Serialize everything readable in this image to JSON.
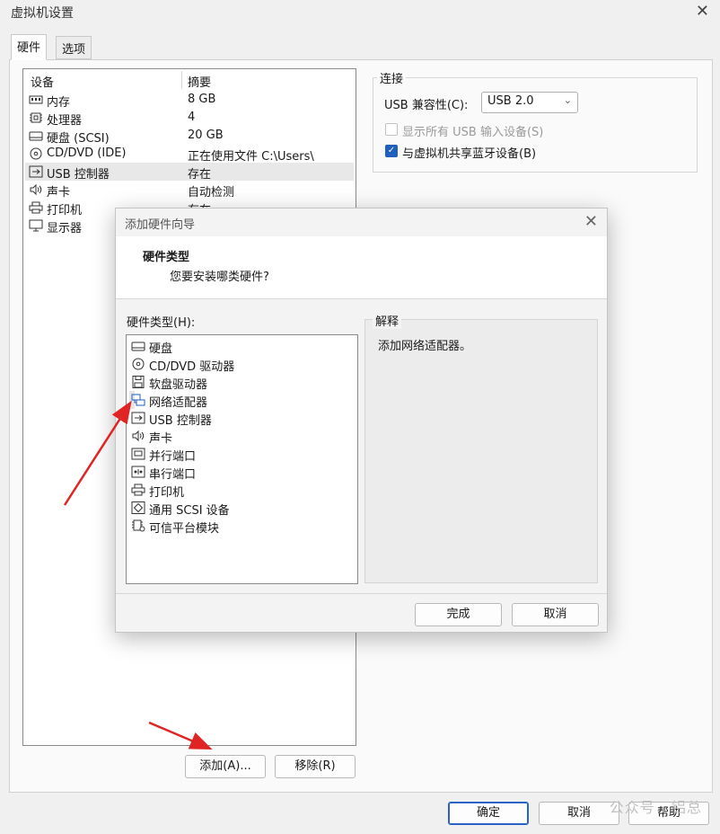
{
  "window": {
    "title": "虚拟机设置"
  },
  "tabs": [
    {
      "label": "硬件"
    },
    {
      "label": "选项"
    }
  ],
  "device_list": {
    "columns": {
      "device": "设备",
      "summary": "摘要"
    },
    "rows": [
      {
        "icon": "memory-icon",
        "name": "内存",
        "summary": "8 GB"
      },
      {
        "icon": "cpu-icon",
        "name": "处理器",
        "summary": "4"
      },
      {
        "icon": "hard-disk-icon",
        "name": "硬盘 (SCSI)",
        "summary": "20 GB"
      },
      {
        "icon": "cd-dvd-icon",
        "name": "CD/DVD (IDE)",
        "summary": "正在使用文件 C:\\Users\\"
      },
      {
        "icon": "usb-icon",
        "name": "USB 控制器",
        "summary": "存在"
      },
      {
        "icon": "speaker-icon",
        "name": "声卡",
        "summary": "自动检测"
      },
      {
        "icon": "printer-icon",
        "name": "打印机",
        "summary": "存在"
      },
      {
        "icon": "monitor-icon",
        "name": "显示器",
        "summary": ""
      }
    ],
    "add_button": "添加(A)...",
    "remove_button": "移除(R)"
  },
  "connection": {
    "title": "连接",
    "usb_compat_label": "USB 兼容性(C):",
    "usb_compat_value": "USB 2.0",
    "show_all_usb": "显示所有 USB 输入设备(S)",
    "share_bluetooth": "与虚拟机共享蓝牙设备(B)"
  },
  "footer": {
    "ok": "确定",
    "cancel": "取消",
    "help": "帮助"
  },
  "wizard": {
    "title": "添加硬件向导",
    "heading": "硬件类型",
    "subheading": "您要安装哪类硬件?",
    "list_label": "硬件类型(H):",
    "items": [
      {
        "icon": "hard-disk-icon",
        "name": "硬盘"
      },
      {
        "icon": "cd-dvd-icon",
        "name": "CD/DVD 驱动器"
      },
      {
        "icon": "floppy-icon",
        "name": "软盘驱动器"
      },
      {
        "icon": "network-adapter-icon",
        "name": "网络适配器"
      },
      {
        "icon": "usb-icon",
        "name": "USB 控制器"
      },
      {
        "icon": "speaker-icon",
        "name": "声卡"
      },
      {
        "icon": "parallel-port-icon",
        "name": "并行端口"
      },
      {
        "icon": "serial-port-icon",
        "name": "串行端口"
      },
      {
        "icon": "printer-icon",
        "name": "打印机"
      },
      {
        "icon": "scsi-device-icon",
        "name": "通用 SCSI 设备"
      },
      {
        "icon": "tpm-icon",
        "name": "可信平台模块"
      }
    ],
    "explain_title": "解释",
    "explain_text": "添加网络适配器。",
    "finish_button": "完成",
    "cancel_button": "取消"
  },
  "watermark": "公众号 · 铝总",
  "colors": {
    "accent": "#1f5fbd",
    "annotation_arrow": "#e02424"
  }
}
